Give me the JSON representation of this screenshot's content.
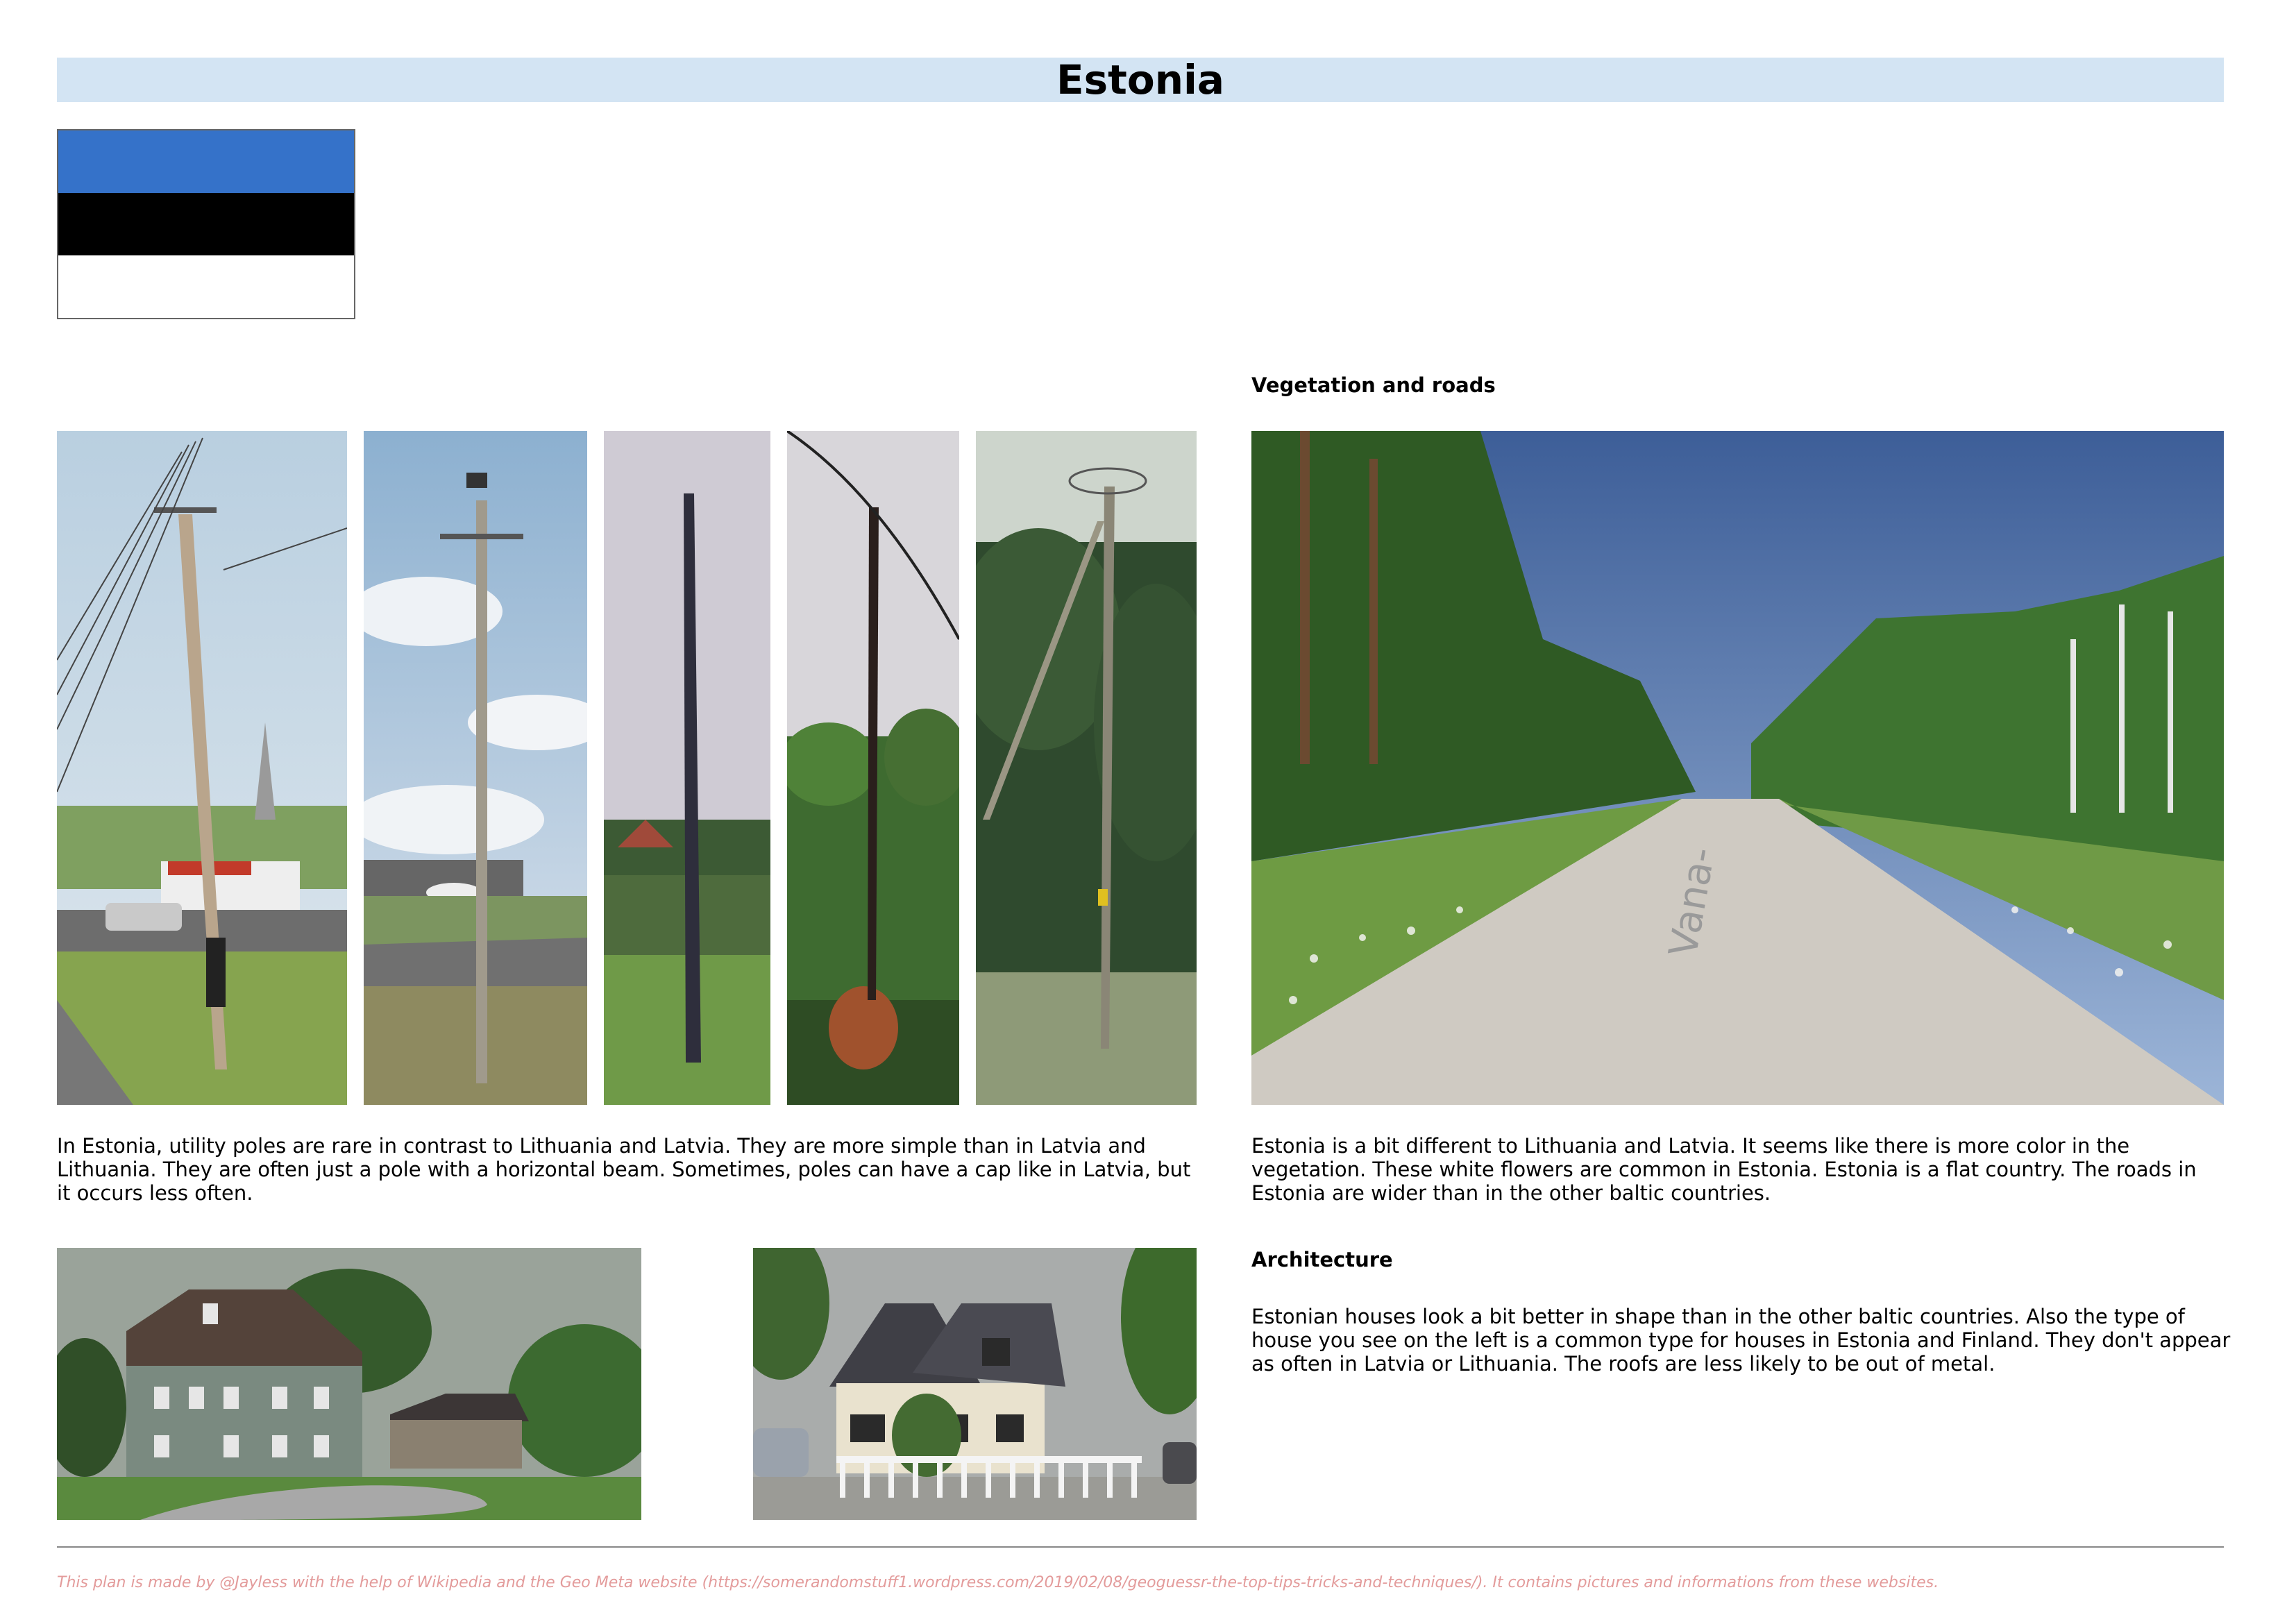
{
  "title": "Estonia",
  "flag": {
    "colors": [
      "#3572c9",
      "#000000",
      "#ffffff"
    ]
  },
  "sections": {
    "vegetation_heading": "Vegetation and roads",
    "architecture_heading": "Architecture"
  },
  "poles_text": "In Estonia, utility poles are rare in contrast to Lithuania and Latvia. They are more simple than in Latvia and Lithuania. They are often just a pole with a horizontal beam. Sometimes, poles can have a cap like in Latvia, but it occurs less often.",
  "vegetation_text": "Estonia is a bit different to Lithuania and Latvia. It seems like there is more color in the vegetation. These white flowers are common in Estonia. Estonia is a flat country. The roads in Estonia are wider than in the other baltic countries.",
  "architecture_text": "Estonian houses look a bit better in shape than in the other baltic countries. Also the type of house you see on the left is a common type for houses in Estonia and Finland. They don't appear as often in Latvia or Lithuania. The roofs are less likely to be out of metal.",
  "road_sign_text": "Vana-",
  "footer": "This plan is made by @Jayless with the help of Wikipedia and the Geo Meta website (https://somerandomstuff1.wordpress.com/2019/02/08/geoguessr-the-top-tips-tricks-and-techniques/). It contains pictures and informations from these websites."
}
